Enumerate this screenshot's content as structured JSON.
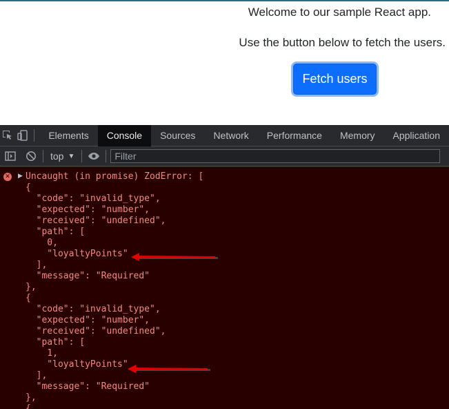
{
  "page": {
    "welcome": "Welcome to our sample React app.",
    "instructions": "Use the button below to fetch the users.",
    "fetch_button": "Fetch users"
  },
  "devtools": {
    "tabs": [
      {
        "label": "Elements",
        "active": false
      },
      {
        "label": "Console",
        "active": true
      },
      {
        "label": "Sources",
        "active": false
      },
      {
        "label": "Network",
        "active": false
      },
      {
        "label": "Performance",
        "active": false
      },
      {
        "label": "Memory",
        "active": false
      },
      {
        "label": "Application",
        "active": false
      }
    ],
    "context": "top",
    "filter_placeholder": "Filter"
  },
  "console": {
    "error_header": "Uncaught (in promise) ZodError: [",
    "lines": [
      "{",
      "  \"code\": \"invalid_type\",",
      "  \"expected\": \"number\",",
      "  \"received\": \"undefined\",",
      "  \"path\": [",
      "    0,",
      "    \"loyaltyPoints\"",
      "  ],",
      "  \"message\": \"Required\"",
      "},",
      "{",
      "  \"code\": \"invalid_type\",",
      "  \"expected\": \"number\",",
      "  \"received\": \"undefined\",",
      "  \"path\": [",
      "    1,",
      "    \"loyaltyPoints\"",
      "  ],",
      "  \"message\": \"Required\"",
      "},",
      "{"
    ]
  },
  "colors": {
    "button_bg": "#0d6efd",
    "console_bg": "#290000",
    "error_text": "#f28b82",
    "annotation_arrow": "#e00000"
  }
}
